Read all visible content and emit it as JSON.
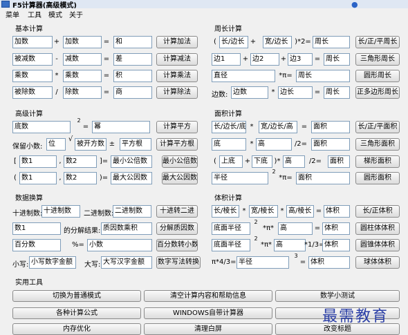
{
  "window": {
    "title": "F5计算器(高级模式)"
  },
  "menubar": {
    "items": [
      "菜单",
      "工具",
      "模式",
      "关于"
    ]
  },
  "sections": {
    "basic": "基本计算",
    "perimeter": "周长计算",
    "advanced": "高级计算",
    "area": "面积计算",
    "conversion": "数据换算",
    "volume": "体积计算",
    "tools": "实用工具"
  },
  "basic": {
    "rows": [
      {
        "a": "加数",
        "op": "+",
        "b": "加数",
        "eq": "=",
        "r": "和",
        "btn": "计算加法"
      },
      {
        "a": "被减数",
        "op": "-",
        "b": "减数",
        "eq": "=",
        "r": "差",
        "btn": "计算减法"
      },
      {
        "a": "乘数",
        "op": "*",
        "b": "乘数",
        "eq": "=",
        "r": "积",
        "btn": "计算乘法"
      },
      {
        "a": "被除数",
        "op": "/",
        "b": "除数",
        "eq": "=",
        "r": "商",
        "btn": "计算除法"
      }
    ]
  },
  "perimeter": {
    "rect": {
      "lp": "(",
      "a": "长/边长",
      "plus": "+",
      "b": "宽/边长",
      "rp": ")*2=",
      "r": "周长",
      "btn": "长/正/平周长"
    },
    "tri": {
      "a": "边1",
      "p1": "+",
      "b": "边2",
      "p2": "+",
      "c": "边3",
      "eq": "=",
      "r": "周长",
      "btn": "三角形周长"
    },
    "circle": {
      "a": "直径",
      "op": "*π=",
      "r": "周长",
      "btn": "圆形周长"
    },
    "polygon": {
      "label": "边数:",
      "a": "边数",
      "op": "*",
      "b": "边长",
      "eq": "=",
      "r": "周长",
      "btn": "正多边形周长"
    }
  },
  "advanced": {
    "square": {
      "a": "底数",
      "exp": "2",
      "eq": "=",
      "r": "幂",
      "btn": "计算平方"
    },
    "sqrt": {
      "label": "保留小数:",
      "a": "位",
      "root": "√",
      "b": "被开方数",
      "pm": "±",
      "r": "平方根",
      "btn": "计算平方根"
    },
    "lcm": {
      "lb": "[",
      "a": "数1",
      "comma": ",",
      "b": "数2",
      "rb": "]=",
      "r": "最小公倍数",
      "btn": "最小公倍数"
    },
    "gcd": {
      "lb": "(",
      "a": "数1",
      "comma": ",",
      "b": "数2",
      "rb": ")=",
      "r": "最大公因数",
      "btn": "最大公因数"
    }
  },
  "area": {
    "rect": {
      "a": "长/边长/底",
      "op": "*",
      "b": "宽/边长/高",
      "eq": "=",
      "r": "面积",
      "btn": "长/正/平面积"
    },
    "tri": {
      "a": "底",
      "op": "*",
      "b": "高",
      "div": "/2=",
      "r": "面积",
      "btn": "三角形面积"
    },
    "trap": {
      "lp": "(",
      "a": "上底",
      "plus": "+",
      "b": "下底",
      "rp": ")*",
      "c": "高",
      "div": "/2=",
      "r": "面积",
      "btn": "梯形面积"
    },
    "circle": {
      "a": "半径",
      "exp": "2",
      "op": "*π=",
      "r": "面积",
      "btn": "圆形面积"
    }
  },
  "conversion": {
    "bin": {
      "l1": "十进制数:",
      "a": "十进制数",
      "l2": "二进制数:",
      "b": "二进制数",
      "btn": "十进转二进"
    },
    "factor": {
      "a": "数1",
      "l": "的分解结果:",
      "r": "质因数乘积",
      "btn": "分解质因数"
    },
    "pct": {
      "a": "百分数",
      "op": "%=",
      "r": "小数",
      "btn": "百分数转小数"
    },
    "cn": {
      "l1": "小写:",
      "a": "小写数字金额",
      "l2": "大写:",
      "b": "大写汉字金额",
      "btn": "数字写法转换"
    }
  },
  "volume": {
    "cuboid": {
      "a": "长/棱长",
      "op1": "*",
      "b": "宽/棱长",
      "op2": "*",
      "c": "高/棱长",
      "eq": "=",
      "r": "体积",
      "btn": "长/正体积"
    },
    "cylinder": {
      "a": "底面半径",
      "exp": "2",
      "op": "*π*",
      "b": "高",
      "eq": "=",
      "r": "体积",
      "btn": "圆柱体体积"
    },
    "cone": {
      "a": "底面半径",
      "exp": "2",
      "op": "*π*",
      "b": "高",
      "div": "*1/3=",
      "r": "体积",
      "btn": "圆锥体体积"
    },
    "sphere": {
      "pre": "π*4/3=",
      "a": "半径",
      "exp": "3",
      "eq": "=",
      "r": "体积",
      "btn": "球体体积"
    }
  },
  "tools": {
    "buttons": [
      "切换为普通模式",
      "清空计算内容和帮助信息",
      "数学小测试",
      "各种计算公式",
      "WINDOWS自带计算器",
      "",
      "内存优化",
      "清理白屏",
      "改变标题"
    ]
  },
  "watermark": "最需教育"
}
